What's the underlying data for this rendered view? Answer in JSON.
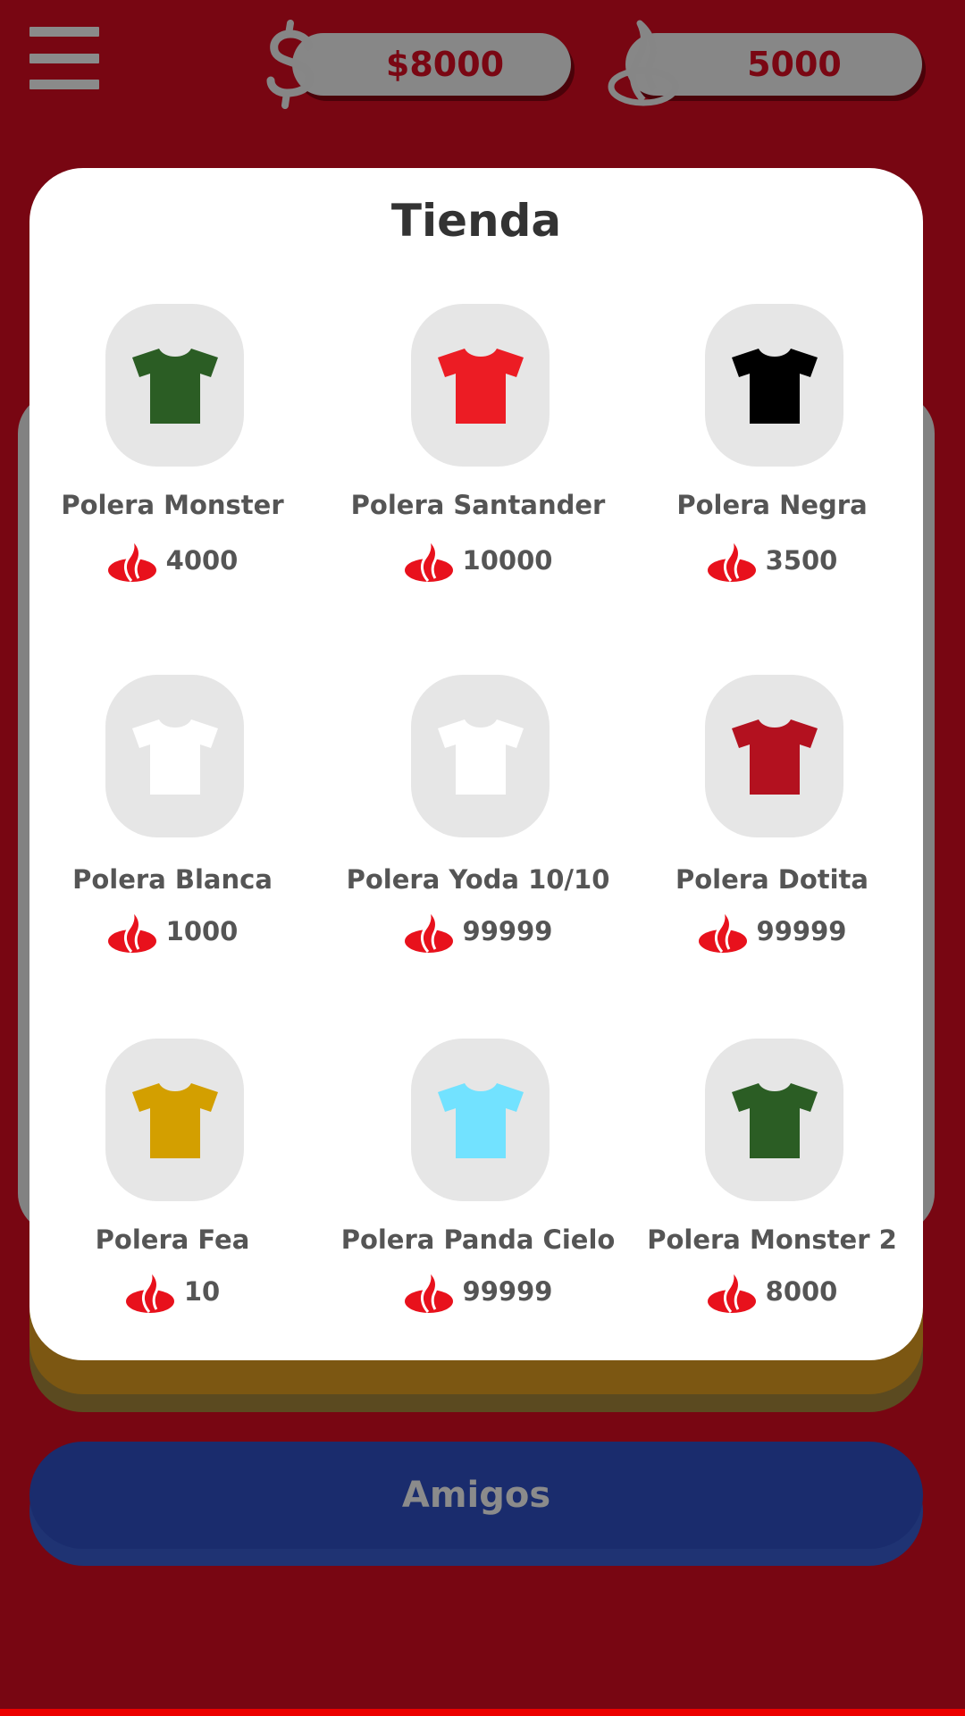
{
  "header": {
    "money": "$8000",
    "points": "5000"
  },
  "store": {
    "title": "Tienda",
    "items": [
      {
        "name": "Polera Monster",
        "price": "4000",
        "color": "#2b5d24"
      },
      {
        "name": "Polera Santander",
        "price": "10000",
        "color": "#ec1c24"
      },
      {
        "name": "Polera Negra",
        "price": "3500",
        "color": "#000000"
      },
      {
        "name": "Polera Blanca",
        "price": "1000",
        "color": "#ffffff"
      },
      {
        "name": "Polera Yoda 10/10",
        "price": "99999",
        "color": "#ffffff"
      },
      {
        "name": "Polera Dotita",
        "price": "99999",
        "color": "#b3111f"
      },
      {
        "name": "Polera Fea",
        "price": "10",
        "color": "#d39f00"
      },
      {
        "name": "Polera Panda Cielo",
        "price": "99999",
        "color": "#72e2ff"
      },
      {
        "name": "Polera Monster 2",
        "price": "8000",
        "color": "#2b5d24"
      }
    ]
  },
  "footer": {
    "amigos_label": "Amigos"
  },
  "colors": {
    "background": "#780612",
    "accent_red": "#ec0000",
    "flame_red": "#e8111c",
    "amigos_blue": "#1a2c6d"
  }
}
